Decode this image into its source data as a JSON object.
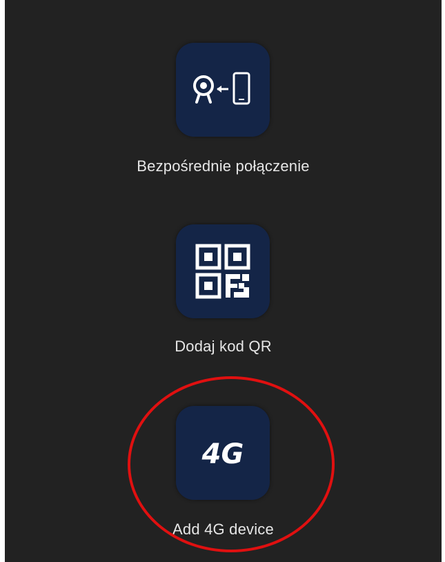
{
  "options": [
    {
      "id": "direct",
      "label": "Bezpośrednie połączenie",
      "icon": "camera-to-phone-icon"
    },
    {
      "id": "qr",
      "label": "Dodaj kod QR",
      "icon": "qr-code-icon"
    },
    {
      "id": "4g",
      "label": "Add 4G device",
      "icon": "4g-logo-icon",
      "icon_text": "4G",
      "highlighted": true
    }
  ],
  "colors": {
    "background": "#222222",
    "tile": "#142547",
    "label": "#e6e6e6",
    "icon": "#ffffff",
    "highlight": "#e01010"
  }
}
